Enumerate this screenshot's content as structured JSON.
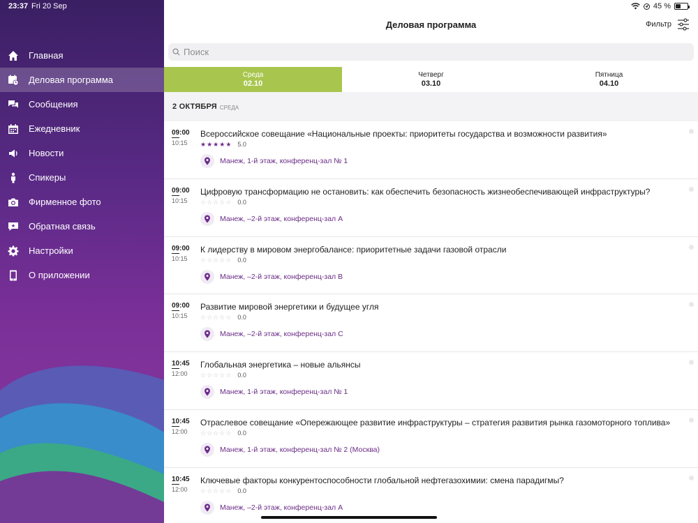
{
  "status_bar": {
    "time": "23:37",
    "date": "Fri 20 Sep",
    "battery": "45 %",
    "battery_level": 0.45
  },
  "sidebar": {
    "items": [
      {
        "label": "Главная",
        "icon": "home-icon",
        "active": false
      },
      {
        "label": "Деловая программа",
        "icon": "calendar-clock-icon",
        "active": true
      },
      {
        "label": "Сообщения",
        "icon": "chat-bubbles-icon",
        "active": false
      },
      {
        "label": "Ежедневник",
        "icon": "calendar-icon",
        "active": false
      },
      {
        "label": "Новости",
        "icon": "megaphone-icon",
        "active": false
      },
      {
        "label": "Спикеры",
        "icon": "speaker-person-icon",
        "active": false
      },
      {
        "label": "Фирменное фото",
        "icon": "camera-icon",
        "active": false
      },
      {
        "label": "Обратная связь",
        "icon": "feedback-icon",
        "active": false
      },
      {
        "label": "Настройки",
        "icon": "gear-icon",
        "active": false
      },
      {
        "label": "О приложении",
        "icon": "phone-icon",
        "active": false
      }
    ]
  },
  "header": {
    "title": "Деловая программа",
    "filter_label": "Фильтр"
  },
  "search": {
    "placeholder": "Поиск",
    "value": ""
  },
  "tabs": [
    {
      "weekday": "Среда",
      "date": "02.10",
      "active": true
    },
    {
      "weekday": "Четверг",
      "date": "03.10",
      "active": false
    },
    {
      "weekday": "Пятница",
      "date": "04.10",
      "active": false
    }
  ],
  "day_header": {
    "date": "2 ОКТЯБРЯ",
    "weekday": "СРЕДА"
  },
  "events": [
    {
      "start": "09:00",
      "end": "10:15",
      "title": "Всероссийское совещание «Национальные проекты: приоритеты государства и возможности развития»",
      "stars": 5,
      "rating": "5.0",
      "location": "Манеж, 1-й этаж, конференц-зал № 1"
    },
    {
      "start": "09:00",
      "end": "10:15",
      "title": "Цифровую трансформацию не остановить: как обеспечить безопасность жизнеобеспечивающей инфраструктуры?",
      "stars": 0,
      "rating": "0.0",
      "location": "Манеж, –2-й этаж, конференц-зал А"
    },
    {
      "start": "09:00",
      "end": "10:15",
      "title": "К лидерству в мировом энергобалансе: приоритетные задачи газовой отрасли",
      "stars": 0,
      "rating": "0.0",
      "location": "Манеж, –2-й этаж, конференц-зал В"
    },
    {
      "start": "09:00",
      "end": "10:15",
      "title": "Развитие мировой энергетики и будущее угля",
      "stars": 0,
      "rating": "0.0",
      "location": "Манеж, –2-й этаж, конференц-зал С"
    },
    {
      "start": "10:45",
      "end": "12:00",
      "title": "Глобальная энергетика – новые альянсы",
      "stars": 0,
      "rating": "0.0",
      "location": "Манеж, 1-й этаж, конференц-зал № 1"
    },
    {
      "start": "10:45",
      "end": "12:00",
      "title": "Отраслевое совещание «Опережающее развитие инфраструктуры – стратегия развития рынка газомоторного топлива»",
      "stars": 0,
      "rating": "0.0",
      "location": "Манеж, 1-й этаж, конференц-зал № 2 (Москва)"
    },
    {
      "start": "10:45",
      "end": "12:00",
      "title": "Ключевые факторы конкурентоспособности глобальной нефтегазохимии: смена парадигмы?",
      "stars": 0,
      "rating": "0.0",
      "location": "Манеж, –2-й этаж, конференц-зал А"
    }
  ],
  "colors": {
    "accent_purple": "#6e2c8e",
    "tab_active": "#a8c64e",
    "sidebar_top": "#3a1f63",
    "sidebar_bottom": "#8a3aa0"
  }
}
